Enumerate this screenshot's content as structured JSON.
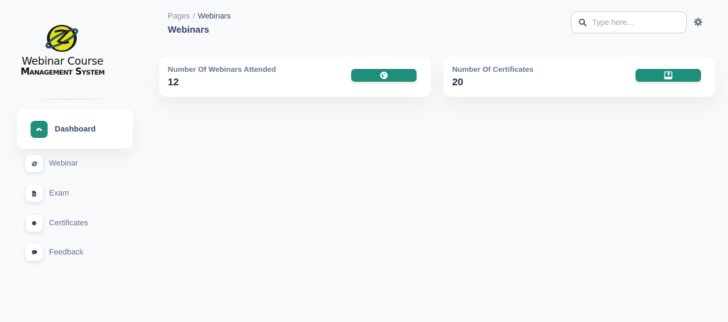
{
  "app": {
    "logo_line1": "Webinar Course",
    "logo_line2": "Management System"
  },
  "sidebar": {
    "items": [
      {
        "label": "Dashboard",
        "icon": "dashboard-icon",
        "active": true
      },
      {
        "label": "Webinar",
        "icon": "webinar-icon"
      },
      {
        "label": "Exam",
        "icon": "document-icon"
      },
      {
        "label": "Certificates",
        "icon": "dot-icon"
      },
      {
        "label": "Feedback",
        "icon": "chat-icon"
      }
    ]
  },
  "header": {
    "breadcrumb_root": "Pages",
    "breadcrumb_separator": "/",
    "breadcrumb_current": "Webinars",
    "title": "Webinars",
    "search_placeholder": "Type here..."
  },
  "cards": [
    {
      "label": "Number Of Webinars Attended",
      "value": "12",
      "button_icon": "globe-icon"
    },
    {
      "label": "Number Of Certificates",
      "value": "20",
      "button_icon": "certificate-icon"
    }
  ],
  "colors": {
    "accent": "#1e8f7a",
    "background": "#f8f9fa",
    "text_dark": "#344767",
    "text_muted": "#67748e",
    "logo_planet": "#e3e21a"
  }
}
